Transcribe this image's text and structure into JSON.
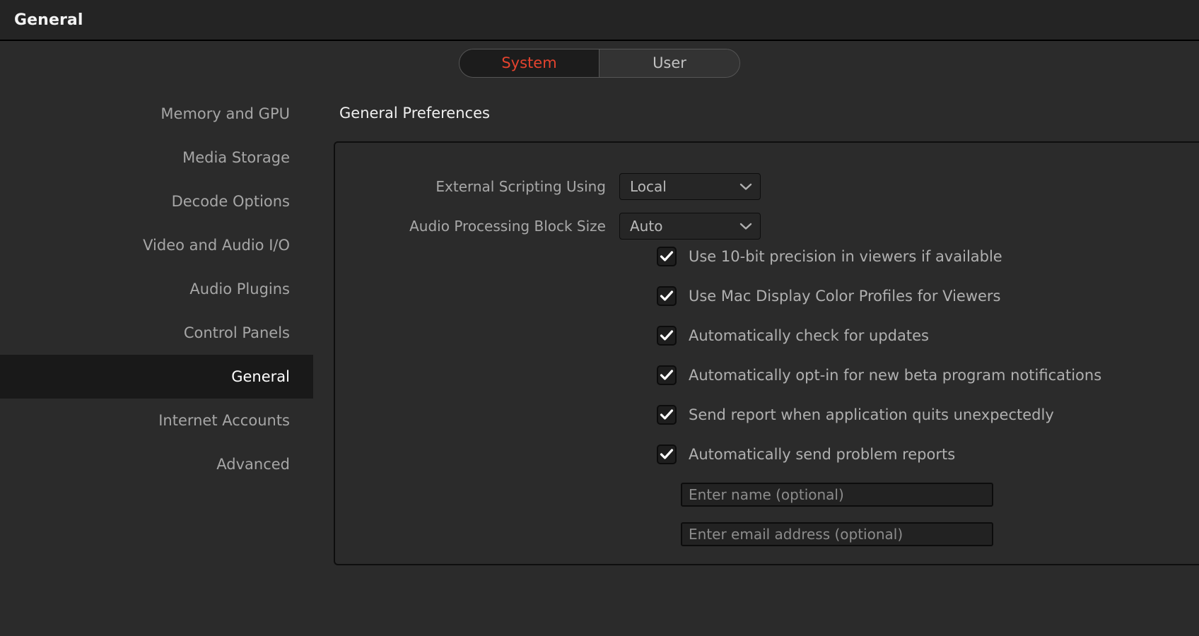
{
  "window": {
    "title": "General"
  },
  "tabs": {
    "items": [
      {
        "label": "System",
        "active": true
      },
      {
        "label": "User",
        "active": false
      }
    ],
    "active_color": "#e5432e",
    "inactive_color": "#c2c2c2"
  },
  "sidebar": {
    "items": [
      {
        "label": "Memory and GPU",
        "selected": false
      },
      {
        "label": "Media Storage",
        "selected": false
      },
      {
        "label": "Decode Options",
        "selected": false
      },
      {
        "label": "Video and Audio I/O",
        "selected": false
      },
      {
        "label": "Audio Plugins",
        "selected": false
      },
      {
        "label": "Control Panels",
        "selected": false
      },
      {
        "label": "General",
        "selected": true
      },
      {
        "label": "Internet Accounts",
        "selected": false
      },
      {
        "label": "Advanced",
        "selected": false
      }
    ]
  },
  "main": {
    "section_title": "General Preferences",
    "dropdowns": [
      {
        "label": "External Scripting Using",
        "value": "Local",
        "icon": "chevron-down-icon"
      },
      {
        "label": "Audio Processing Block Size",
        "value": "Auto",
        "icon": "chevron-down-icon"
      }
    ],
    "checkboxes": [
      {
        "label": "Use 10-bit precision in viewers if available",
        "checked": true
      },
      {
        "label": "Use Mac Display Color Profiles for Viewers",
        "checked": true
      },
      {
        "label": "Automatically check for updates",
        "checked": true
      },
      {
        "label": "Automatically opt-in for new beta program notifications",
        "checked": true
      },
      {
        "label": "Send report when application quits unexpectedly",
        "checked": true
      },
      {
        "label": "Automatically send problem reports",
        "checked": true
      }
    ],
    "inputs": [
      {
        "placeholder": "Enter name (optional)",
        "value": ""
      },
      {
        "placeholder": "Enter email address (optional)",
        "value": ""
      }
    ]
  },
  "theme": {
    "background": "#2b2b2b",
    "titlebar": "#242424",
    "selected_row": "#191919",
    "accent": "#e5432e",
    "label_text": "#a8a8a8",
    "heading_text": "#f0f0f0"
  }
}
